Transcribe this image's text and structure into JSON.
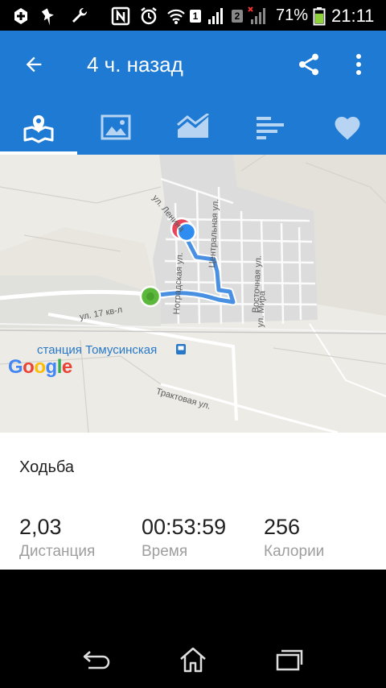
{
  "status_bar": {
    "sim1": "1",
    "sim2": "2",
    "battery_percent": "71%",
    "battery_level": 0.71,
    "clock": "21:11"
  },
  "app_bar": {
    "title": "4 ч. назад",
    "back_icon": "arrow-back-icon",
    "share_icon": "share-icon",
    "overflow_icon": "more-vert-icon",
    "color": "#1e7ad3"
  },
  "tabs": [
    {
      "icon": "map-icon",
      "active": true
    },
    {
      "icon": "photo-icon",
      "active": false
    },
    {
      "icon": "chart-icon",
      "active": false
    },
    {
      "icon": "bars-icon",
      "active": false
    },
    {
      "icon": "heart-icon",
      "active": false
    }
  ],
  "map": {
    "streets": {
      "lenina": "ул. Ленина",
      "tsentralnaya": "Центральная ул.",
      "vostochnaya": "Восточная ул.",
      "nogradskaya": "Ноградская ул.",
      "mira": "ул. Мира",
      "kv17": "ул. 17 кв-л",
      "traktovaya": "Трактовая ул."
    },
    "station": "станция Томусинская",
    "logo": "Google",
    "route_color": "#4a90e2",
    "start_color": "#5cb83a",
    "end_color": "#e8455a"
  },
  "activity": {
    "type": "Ходьба",
    "stats": [
      {
        "value": "2,03",
        "label": "Дистанция"
      },
      {
        "value": "00:53:59",
        "label": "Время"
      },
      {
        "value": "256",
        "label": "Калории"
      }
    ]
  },
  "nav_bar": {
    "back_icon": "back-nav-icon",
    "home_icon": "home-icon",
    "recents_icon": "recents-icon"
  }
}
